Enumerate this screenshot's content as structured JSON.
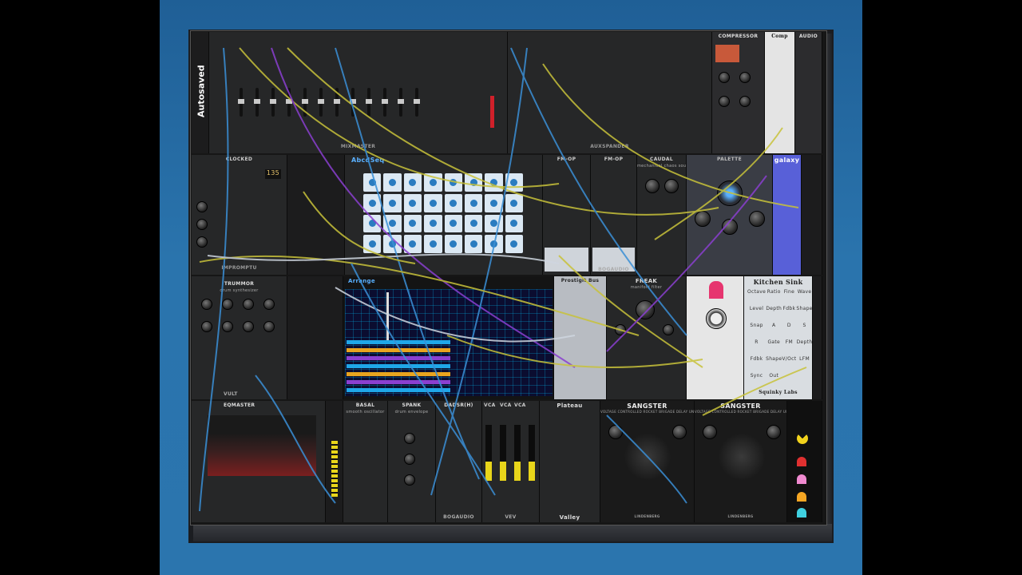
{
  "rack": {
    "autosaved_label": "Autosaved"
  },
  "modules": {
    "mixmaster": "MIXMASTER",
    "auxspander": "AUXSPANDER",
    "compressor": "COMPRESSOR",
    "comp": "Comp",
    "audio": "AUDIO",
    "clocked": "CLOCKED",
    "clocked_bpm": "135",
    "impromptu": "IMPROMPTU",
    "abcdseq": "AbcdSeq",
    "fm_op_1": "FM-OP",
    "fm_op_2": "FM-OP",
    "bogaudio": "BOGAUDIO",
    "caudal": "CAUDAL",
    "caudal_sub": "mechanical chaos source",
    "palette": "PALETTE",
    "galaxy": "galaxy",
    "trummor": "TRUMMOR",
    "trummor_sub": "drum synthesizer",
    "vult": "VULT",
    "arrange": "Arrange",
    "prostigiit": "Prostigit Bus",
    "freak": "FREAK",
    "freak_sub": "manifold filter",
    "kitchen_sink": "Kitchen Sink",
    "kitchen_sink_footer": "Squinky Labs",
    "eqmaster": "EQMASTER",
    "basal": "BASAL",
    "basal_sub": "smooth oscillator",
    "spank": "SPANK",
    "spank_sub": "drum envelope",
    "dadsr": "DADSR(H)",
    "vca": "VCA",
    "vev": "VEV",
    "plateau": "Plateau",
    "valley": "Valley",
    "sangster_1": "SANGSTER",
    "sangster_2": "SANGSTER",
    "sangster_sub": "VOLTAGE CONTROLLED ROCKET BRIGADE DELAY UNIT",
    "lindenberg": "LINDENBERG"
  },
  "kitchen_sink_labels": [
    "Octave",
    "Ratio",
    "Fine",
    "Wave",
    "Level",
    "Depth",
    "Fdbk",
    "Shape",
    "Snap",
    "A",
    "D",
    "S",
    "R",
    "Gate",
    "FM",
    "Depth",
    "Fdbk",
    "Shape",
    "V/Oct",
    "LFM",
    "Sync",
    "Out"
  ],
  "colors": {
    "background": "#2b75ae",
    "rack": "#161616",
    "cable_blue": "#3a8fd6",
    "cable_yellow": "#c8c23a",
    "cable_purple": "#8a3fd0",
    "cable_white": "#cfd6e0"
  }
}
